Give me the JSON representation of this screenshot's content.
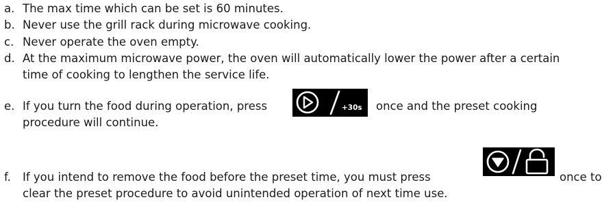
{
  "items": [
    {
      "marker": "a.",
      "text": "The max time which can be set is 60 minutes."
    },
    {
      "marker": "b.",
      "text": "Never use the grill rack during microwave cooking."
    },
    {
      "marker": "c.",
      "text": "Never operate the oven empty."
    },
    {
      "marker": "d.",
      "text": "At the maximum microwave power, the oven will automatically lower the power after a certain",
      "cont": "time of cooking to lengthen the service life."
    },
    {
      "marker": "e.",
      "text": "If you turn the food during operation, press",
      "after": "once and the preset cooking",
      "cont": "procedure will continue."
    },
    {
      "marker": "f.",
      "text": "If you intend to remove the food before the preset time, you must press",
      "after": "once to",
      "cont": "clear the preset procedure to avoid unintended operation of next time use."
    }
  ],
  "buttons": {
    "start": {
      "icon": "play-circle-icon",
      "label": "+30s"
    },
    "stop": {
      "icon": "stop-circle-icon",
      "lock_icon": "lock-icon"
    }
  }
}
